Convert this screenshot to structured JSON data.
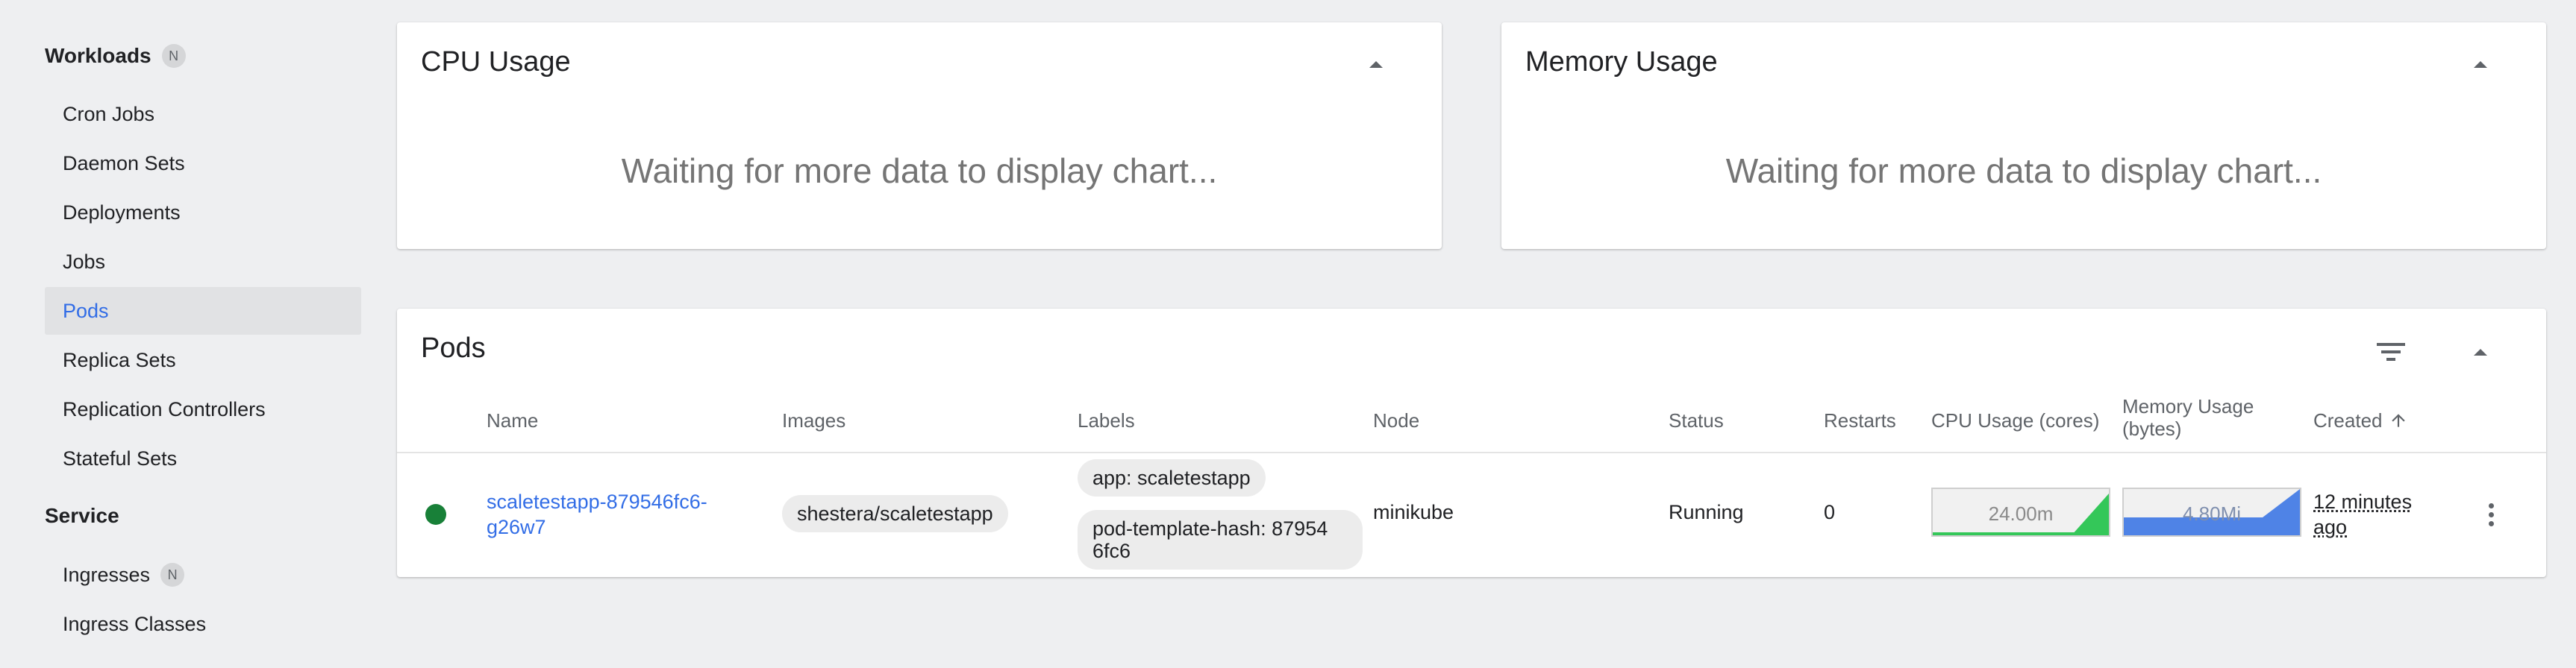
{
  "sidebar": {
    "workloads": {
      "title": "Workloads",
      "badge": "N",
      "items": [
        {
          "label": "Cron Jobs"
        },
        {
          "label": "Daemon Sets"
        },
        {
          "label": "Deployments"
        },
        {
          "label": "Jobs"
        },
        {
          "label": "Pods",
          "active": true
        },
        {
          "label": "Replica Sets"
        },
        {
          "label": "Replication Controllers"
        },
        {
          "label": "Stateful Sets"
        }
      ]
    },
    "service": {
      "title": "Service",
      "items": [
        {
          "label": "Ingresses",
          "badge": "N"
        },
        {
          "label": "Ingress Classes"
        }
      ]
    }
  },
  "cpu_card": {
    "title": "CPU Usage",
    "message": "Waiting for more data to display chart..."
  },
  "memory_card": {
    "title": "Memory Usage",
    "message": "Waiting for more data to display chart..."
  },
  "pods": {
    "title": "Pods",
    "columns": {
      "name": "Name",
      "images": "Images",
      "labels": "Labels",
      "node": "Node",
      "status": "Status",
      "restarts": "Restarts",
      "cpu": "CPU Usage (cores)",
      "memory_line1": "Memory Usage",
      "memory_line2": "(bytes)",
      "created": "Created"
    },
    "sort_icon": "arrow-up-icon",
    "rows": [
      {
        "name_line1": "scaletestapp-879546fc6-",
        "name_line2": "g26w7",
        "image": "shestera/scaletestapp",
        "label1": "app: scaletestapp",
        "label2_line1": "pod-template-hash: 87954",
        "label2_line2": "6fc6",
        "node": "minikube",
        "status": "Running",
        "restarts": "0",
        "cpu": "24.00m",
        "memory": "4.80Mi",
        "created_line1": "12 minutes",
        "created_line2": "ago"
      }
    ]
  },
  "colors": {
    "accent": "#326de6",
    "running": "#188038",
    "cpu_spark": "#34c759",
    "memory_spark": "#4f83e6"
  }
}
